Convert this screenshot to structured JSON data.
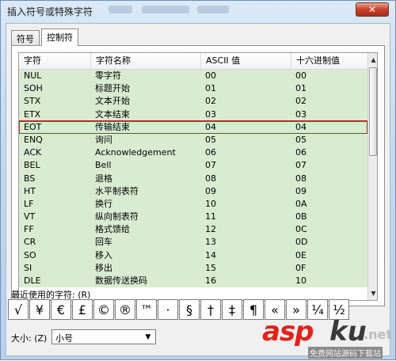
{
  "window": {
    "title": "插入符号或特殊字符",
    "close_glyph": "✕"
  },
  "tabs": [
    {
      "label": "符号",
      "active": false
    },
    {
      "label": "控制符",
      "active": true
    }
  ],
  "grid": {
    "columns": [
      "字符",
      "字符名称",
      "ASCII 值",
      "十六进制值"
    ],
    "selected_row": 4,
    "rows": [
      [
        "NUL",
        "零字符",
        "00",
        "00"
      ],
      [
        "SOH",
        "标题开始",
        "01",
        "01"
      ],
      [
        "STX",
        "文本开始",
        "02",
        "02"
      ],
      [
        "ETX",
        "文本结束",
        "03",
        "03"
      ],
      [
        "EOT",
        "传输结束",
        "04",
        "04"
      ],
      [
        "ENQ",
        "询问",
        "05",
        "05"
      ],
      [
        "ACK",
        "Acknowledgement",
        "06",
        "06"
      ],
      [
        "BEL",
        "Bell",
        "07",
        "07"
      ],
      [
        "BS",
        "退格",
        "08",
        "08"
      ],
      [
        "HT",
        "水平制表符",
        "09",
        "09"
      ],
      [
        "LF",
        "换行",
        "10",
        "0A"
      ],
      [
        "VT",
        "纵向制表符",
        "11",
        "0B"
      ],
      [
        "FF",
        "格式馈给",
        "12",
        "0C"
      ],
      [
        "CR",
        "回车",
        "13",
        "0D"
      ],
      [
        "SO",
        "移入",
        "14",
        "0E"
      ],
      [
        "SI",
        "移出",
        "15",
        "0F"
      ],
      [
        "DLE",
        "数据传送换码",
        "16",
        "10"
      ]
    ]
  },
  "recent": {
    "label": "最近使用的字符: (R)",
    "chars": [
      "√",
      "¥",
      "€",
      "£",
      "©",
      "®",
      "™",
      "·",
      "§",
      "†",
      "‡",
      "¶",
      "«",
      "»",
      "¼",
      "½"
    ]
  },
  "size": {
    "label": "大小: (Z)",
    "value": "小号"
  },
  "watermark": {
    "asp": "asp",
    "ku": "ku",
    "net": ".net",
    "sub": "免费网站源码下载站"
  },
  "colors": {
    "row_green": "#d9ecd1",
    "selection_outline": "#d0202b",
    "close_red": "#c5412b"
  }
}
